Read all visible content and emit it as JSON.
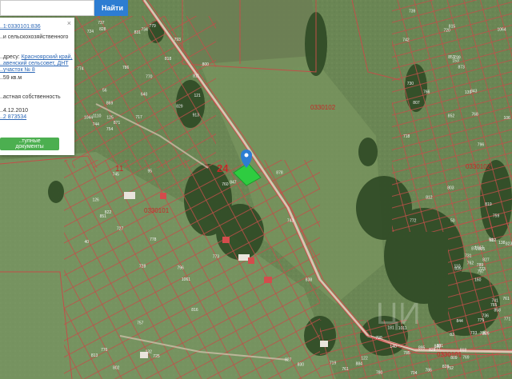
{
  "search": {
    "placeholder": "",
    "button_label": "Найти"
  },
  "info_card": {
    "cadastral_number": "..1:0330101:836",
    "category": "..и сельскохозяйственного",
    "address_label": "..дресу:",
    "address_line1": "Красноярский край,",
    "address_line2": "..авенский сельсовет, ДНТ",
    "address_line3": "..участок № 8",
    "area": "..59 кв.м",
    "ownership": "..астная собственность",
    "date": "..4.12.2010",
    "value": "..2 873534",
    "docs_button": "..тупные документы",
    "close": "×"
  },
  "map_labels": {
    "area_number_main": "24",
    "area_number_left": "11",
    "quarter_codes": [
      "0330101",
      "0330101",
      "0330102",
      "0330102",
      "0330101"
    ],
    "parcel_numbers": [
      "640",
      "851",
      "852",
      "844",
      "848",
      "871",
      "847",
      "799",
      "832",
      "829",
      "828",
      "830",
      "807",
      "823",
      "785",
      "818",
      "802",
      "853",
      "827",
      "884",
      "786",
      "813",
      "812",
      "805",
      "801",
      "829",
      "822",
      "815",
      "839",
      "809",
      "800",
      "796",
      "803",
      "797",
      "798",
      "793",
      "757",
      "759",
      "771",
      "769",
      "779",
      "778",
      "766",
      "765",
      "780",
      "774",
      "773",
      "772",
      "775",
      "777",
      "744",
      "743",
      "742",
      "741",
      "752",
      "754",
      "745",
      "739",
      "736",
      "735",
      "734",
      "728",
      "730",
      "731",
      "733",
      "737",
      "760",
      "720",
      "723",
      "719",
      "717",
      "725",
      "796",
      "762",
      "761",
      "724",
      "727",
      "718",
      "789",
      "786",
      "770",
      "776",
      "768",
      "761",
      "704",
      "811",
      "816",
      "819",
      "826",
      "828",
      "831",
      "838",
      "843",
      "858",
      "895",
      "913",
      "40",
      "50",
      "51",
      "83",
      "56",
      "95",
      "106",
      "110",
      "122",
      "125",
      "132",
      "139",
      "138",
      "140",
      "121",
      "126",
      "153",
      "160",
      "181",
      "1044",
      "1061",
      "1064",
      "1017",
      "1011",
      "1110",
      "878",
      "873",
      "872",
      "868",
      "869",
      "827"
    ]
  },
  "colors": {
    "map_marker": "#2d7dd2",
    "selected_parcel": "#2ecc40",
    "parcel_lines": "#d24b4b",
    "road": "#d24b4b",
    "docs_button": "#4caf50"
  },
  "icons": {
    "search_button": "search-icon",
    "marker": "map-pin-icon"
  }
}
